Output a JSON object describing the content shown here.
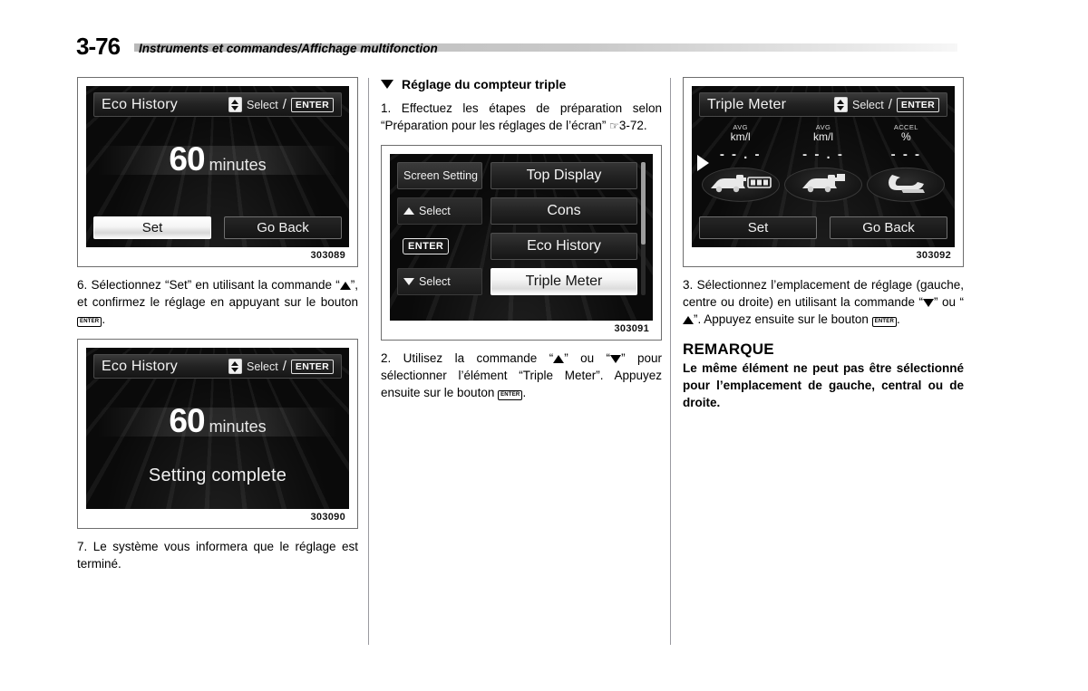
{
  "header": {
    "page_number": "3-76",
    "title": "Instruments et commandes/Affichage multifonction"
  },
  "column1": {
    "figure1": {
      "caption": "303089",
      "screen": {
        "title": "Eco History",
        "hint_select": "Select",
        "hint_enter": "ENTER",
        "value": "60",
        "unit": "minutes",
        "button_set": "Set",
        "button_go_back": "Go Back",
        "selected_button": "Set"
      }
    },
    "step6": "6. Sélectionnez “Set” en utilisant la commande “",
    "step6_end": "”, et confirmez le réglage en appuyant sur le bouton ",
    "step6_period": ".",
    "figure2": {
      "caption": "303090",
      "screen": {
        "title": "Eco History",
        "hint_select": "Select",
        "hint_enter": "ENTER",
        "value": "60",
        "unit": "minutes",
        "message": "Setting complete"
      }
    },
    "step7": "7. Le système vous informera que le réglage est terminé."
  },
  "column2": {
    "section_heading": "Réglage du compteur triple",
    "step1_a": "1. Effectuez les étapes de préparation selon “Préparation pour les réglages de l’écran” ",
    "step1_ref": "3-72.",
    "figure3": {
      "caption": "303091",
      "screen": {
        "left_label": "Screen Setting",
        "up_select": "Select",
        "enter": "ENTER",
        "down_select": "Select",
        "menu_items": [
          {
            "label": "Top Display",
            "selected": false
          },
          {
            "label": "Cons",
            "selected": false
          },
          {
            "label": "Eco History",
            "selected": false
          },
          {
            "label": "Triple Meter",
            "selected": true
          }
        ]
      }
    },
    "step2_a": "2. Utilisez la commande “",
    "step2_b": "” ou “",
    "step2_c": "” pour sélectionner l’élément “Triple Meter”. Appuyez ensuite sur le bouton ",
    "step2_end": "."
  },
  "column3": {
    "figure4": {
      "caption": "303092",
      "screen": {
        "title": "Triple Meter",
        "hint_select": "Select",
        "hint_enter": "ENTER",
        "gauges": [
          {
            "sup": "AVG",
            "unit": "km/l",
            "value": "- - . -",
            "icon": "car-fuel-odo-icon"
          },
          {
            "sup": "AVG",
            "unit": "km/l",
            "value": "- - . -",
            "icon": "car-fuel-trip-icon"
          },
          {
            "sup": "ACCEL",
            "unit": "%",
            "value": "- - -",
            "icon": "accel-pedal-icon"
          }
        ],
        "button_set": "Set",
        "button_go_back": "Go Back"
      }
    },
    "step3_a": "3. Sélectionnez l’emplacement de réglage (gauche, centre ou droite) en utilisant la commande “",
    "step3_b": "” ou “",
    "step3_c": "”. Appuyez ensuite sur le bouton ",
    "step3_end": ".",
    "note_heading": "REMARQUE",
    "note_body": "Le même élément ne peut pas être sélectionné pour l’emplacement de gauche, central ou de droite."
  },
  "colors": {
    "screen_background": "#0a0a0a",
    "selected_highlight": "#ffffff",
    "rule_gray": "#b9b9b9"
  }
}
